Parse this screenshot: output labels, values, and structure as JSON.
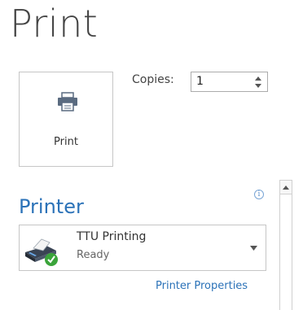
{
  "page": {
    "title": "Print"
  },
  "print_button": {
    "label": "Print"
  },
  "copies": {
    "label": "Copies:",
    "value": "1"
  },
  "printer_section": {
    "heading": "Printer",
    "info_icon": "i",
    "selected_printer": {
      "name": "TTU Printing",
      "status": "Ready"
    },
    "properties_link": "Printer Properties"
  },
  "icons": {
    "print_button_icon": "printer-icon",
    "printer_device_icon": "printer-ready-icon",
    "info": "info-icon",
    "dropdown": "chevron-down-icon",
    "spin_up": "spin-up-icon",
    "spin_down": "spin-down-icon",
    "scroll_up": "scroll-up-arrow-icon"
  },
  "colors": {
    "accent": "#2b72b8",
    "text": "#444444",
    "border": "#c6c6c6",
    "status_ok": "#3aa43a"
  }
}
